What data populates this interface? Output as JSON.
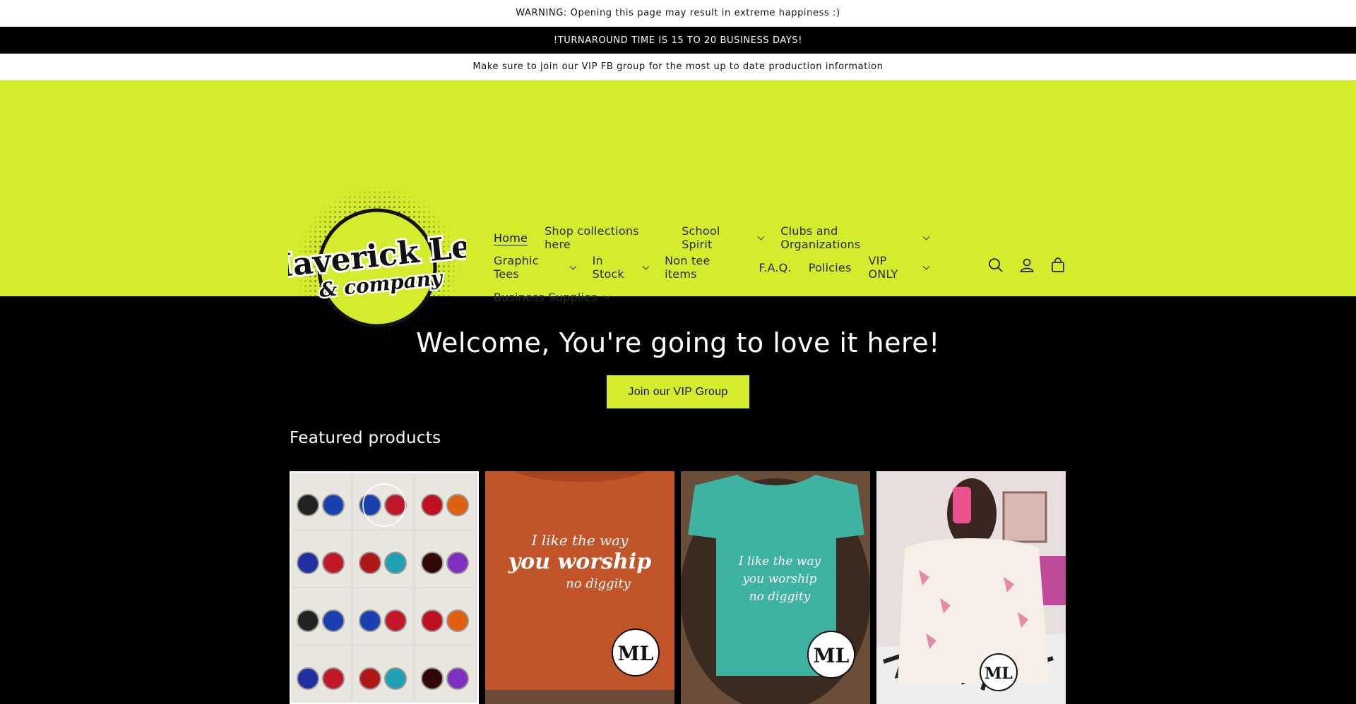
{
  "announcements": [
    "WARNING: Opening this page may result in extreme happiness :)",
    "!TURNAROUND TIME IS 15 TO 20 BUSINESS DAYS!",
    "Make sure to join our VIP FB group for the most up to date production information"
  ],
  "logo": {
    "line1": "Maverick Lee",
    "line2": "& company"
  },
  "nav": {
    "row1": [
      {
        "label": "Home",
        "dropdown": false,
        "active": true
      },
      {
        "label": "Shop collections here",
        "dropdown": false
      },
      {
        "label": "School Spirit",
        "dropdown": true
      },
      {
        "label": "Clubs and Organizations",
        "dropdown": true
      }
    ],
    "row2": [
      {
        "label": "Graphic Tees",
        "dropdown": true
      },
      {
        "label": "In Stock",
        "dropdown": true
      },
      {
        "label": "Non tee items",
        "dropdown": false
      },
      {
        "label": "F.A.Q.",
        "dropdown": false
      },
      {
        "label": "Policies",
        "dropdown": false
      },
      {
        "label": "VIP ONLY",
        "dropdown": true
      }
    ],
    "row3": [
      {
        "label": "Business Supplies",
        "dropdown": true
      }
    ]
  },
  "header_icons": [
    "search-icon",
    "account-icon",
    "cart-icon"
  ],
  "hero": {
    "title": "Welcome, You're going to love it here!",
    "button": "Join our VIP Group"
  },
  "featured": {
    "heading": "Featured products",
    "shirt1_text": [
      "I like the way",
      "you worship",
      "no diggity"
    ],
    "shirt2_text": [
      "I like the way",
      "you worship",
      "no diggity"
    ],
    "badge": "ML"
  },
  "colors": {
    "brand": "#d4ec2c",
    "dark": "#000000",
    "shirt_orange": "#c75a2a",
    "shirt_teal": "#3fb3a1"
  }
}
